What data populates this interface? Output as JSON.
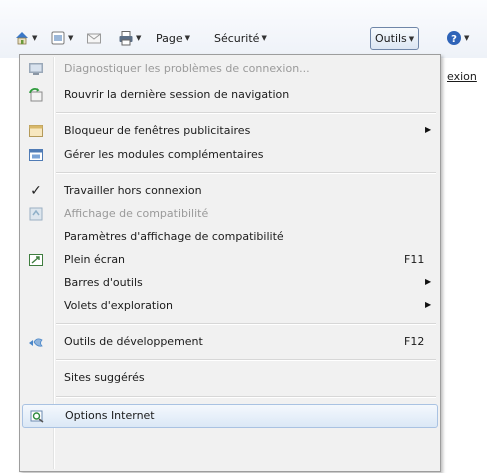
{
  "toolbar": {
    "items": [
      {
        "icon": "home-icon"
      },
      {
        "icon": "feeds-icon"
      },
      {
        "icon": "mail-icon"
      },
      {
        "icon": "print-icon"
      },
      {
        "label": "Page"
      },
      {
        "label": "Sécurité"
      },
      {
        "label": "Outils"
      },
      {
        "icon": "help-icon"
      }
    ]
  },
  "background_link": "exion",
  "menu": {
    "items": [
      {
        "label": "Diagnostiquer les problèmes de connexion...",
        "disabled": true,
        "icon": "diagnose-connection-icon"
      },
      {
        "label": "Rouvrir la dernière session de navigation",
        "icon": "reopen-session-icon"
      },
      {
        "label": "Bloqueur de fenêtres publicitaires",
        "submenu": true,
        "icon": "popup-blocker-icon"
      },
      {
        "label": "Gérer les modules complémentaires",
        "icon": "addons-icon"
      },
      {
        "label": "Travailler hors connexion",
        "checked": true,
        "icon": "checkmark-icon"
      },
      {
        "label": "Affichage de compatibilité",
        "disabled": true,
        "icon": "compatibility-view-icon"
      },
      {
        "label": "Paramètres d'affichage de compatibilité"
      },
      {
        "label": "Plein écran",
        "shortcut": "F11",
        "icon": "fullscreen-icon"
      },
      {
        "label": "Barres d'outils",
        "submenu": true
      },
      {
        "label": "Volets d'exploration",
        "submenu": true
      },
      {
        "label": "Outils de développement",
        "shortcut": "F12",
        "icon": "developer-tools-icon"
      },
      {
        "label": "Sites suggérés"
      },
      {
        "label": "Options Internet",
        "icon": "internet-options-icon",
        "highlighted": true
      }
    ]
  },
  "colors": {
    "menu_bg": "#f1f1f1",
    "highlight": "#dbe8f6",
    "disabled_text": "#9a9a9a",
    "tools_border": "#6f86a8"
  }
}
